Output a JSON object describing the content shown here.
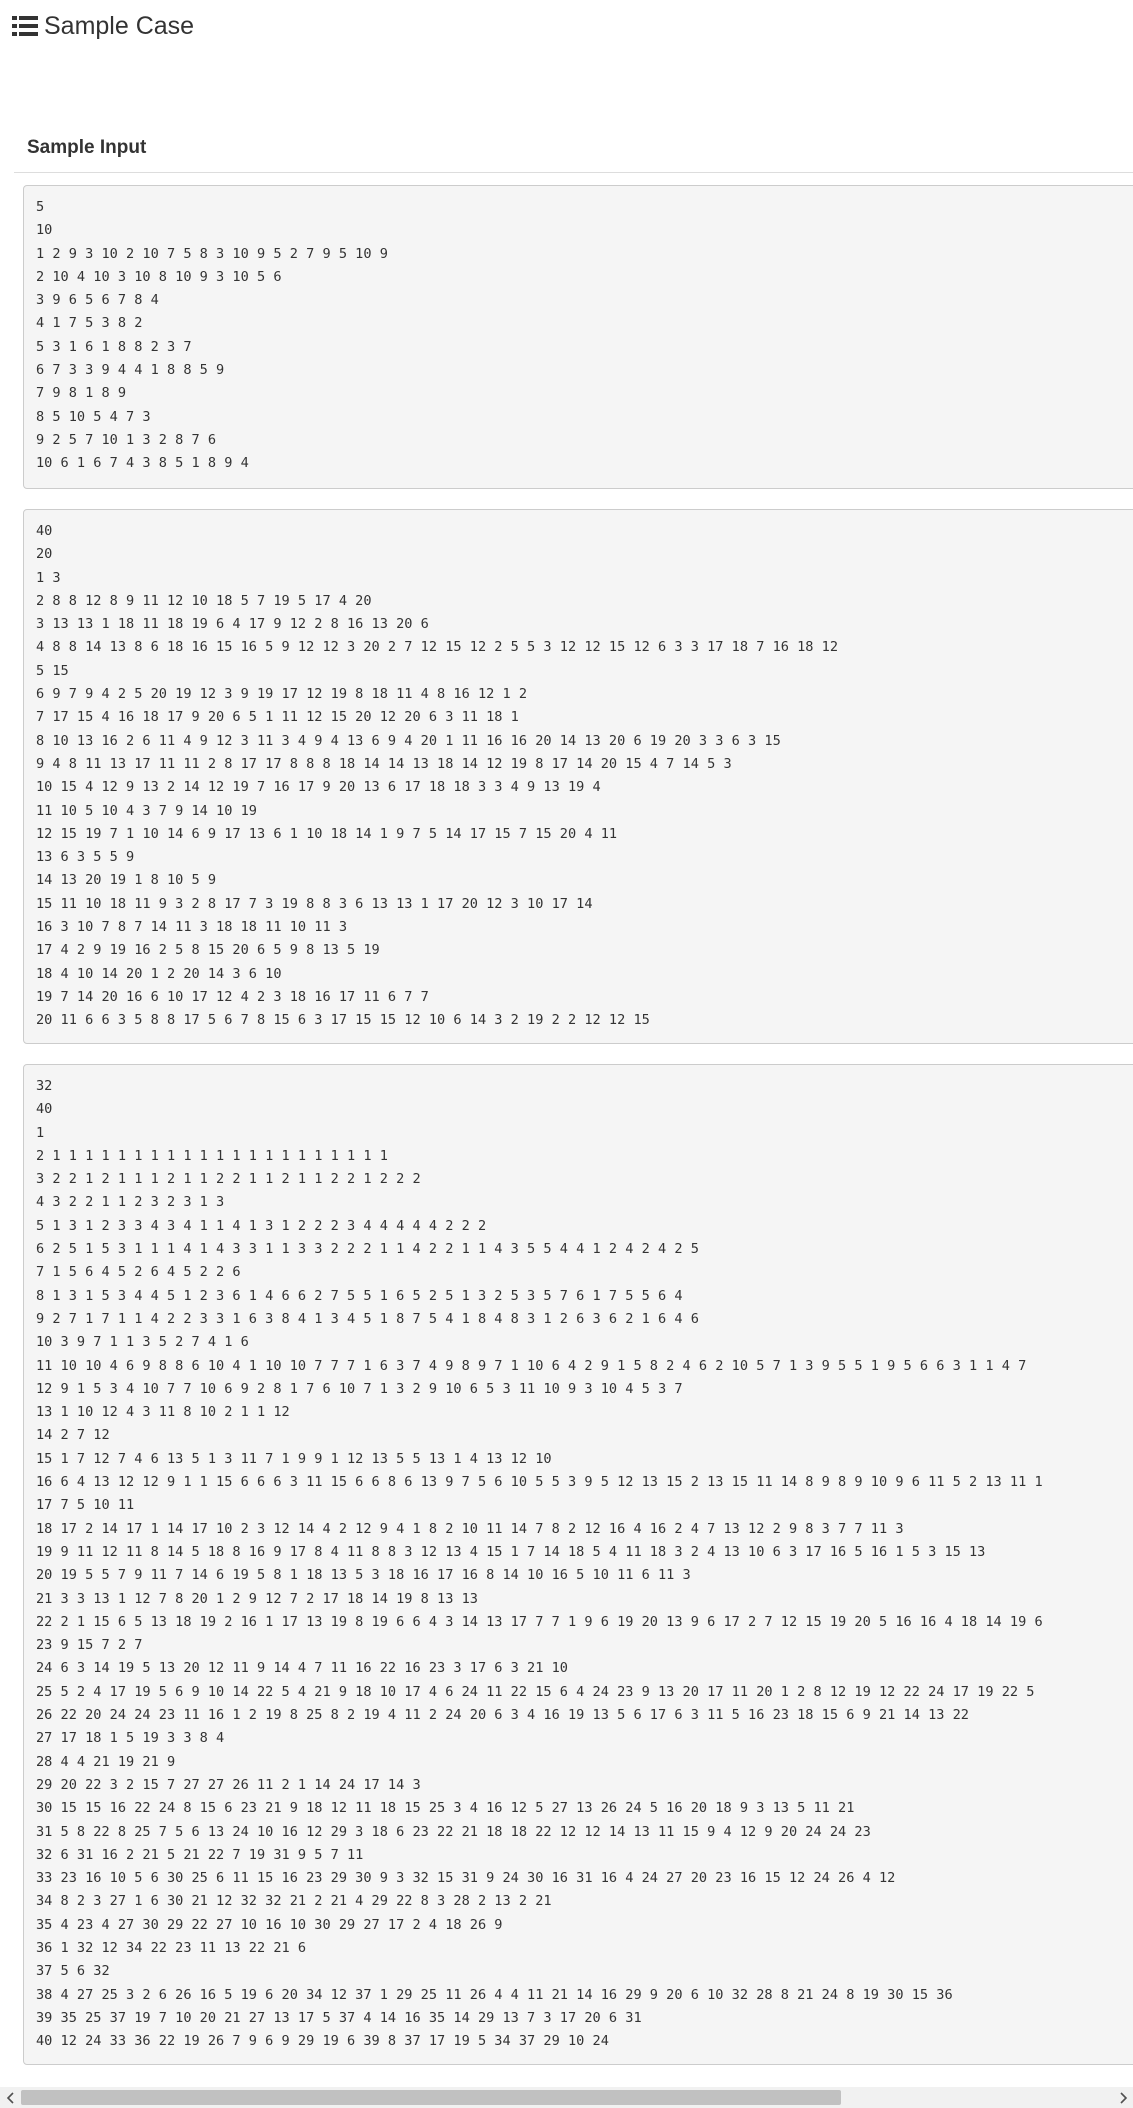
{
  "header": {
    "title": "Sample Case"
  },
  "section": {
    "title": "Sample Input"
  },
  "blocks": [
    {
      "lines": [
        "5",
        "10",
        "1 2 9 3 10 2 10 7 5 8 3 10 9 5 2 7 9 5 10 9",
        "2 10 4 10 3 10 8 10 9 3 10 5 6",
        "3 9 6 5 6 7 8 4",
        "4 1 7 5 3 8 2",
        "5 3 1 6 1 8 8 2 3 7",
        "6 7 3 3 9 4 4 1 8 8 5 9",
        "7 9 8 1 8 9",
        "8 5 10 5 4 7 3",
        "9 2 5 7 10 1 3 2 8 7 6",
        "10 6 1 6 7 4 3 8 5 1 8 9 4"
      ]
    },
    {
      "lines": [
        "40",
        "20",
        "1 3",
        "2 8 8 12 8 9 11 12 10 18 5 7 19 5 17 4 20",
        "3 13 13 1 18 11 18 19 6 4 17 9 12 2 8 16 13 20 6",
        "4 8 8 14 13 8 6 18 16 15 16 5 9 12 12 3 20 2 7 12 15 12 2 5 5 3 12 12 15 12 6 3 3 17 18 7 16 18 12",
        "5 15",
        "6 9 7 9 4 2 5 20 19 12 3 9 19 17 12 19 8 18 11 4 8 16 12 1 2",
        "7 17 15 4 16 18 17 9 20 6 5 1 11 12 15 20 12 20 6 3 11 18 1",
        "8 10 13 16 2 6 11 4 9 12 3 11 3 4 9 4 13 6 9 4 20 1 11 16 16 20 14 13 20 6 19 20 3 3 6 3 15",
        "9 4 8 11 13 17 11 11 2 8 17 17 8 8 8 18 14 14 13 18 14 12 19 8 17 14 20 15 4 7 14 5 3",
        "10 15 4 12 9 13 2 14 12 19 7 16 17 9 20 13 6 17 18 18 3 3 4 9 13 19 4",
        "11 10 5 10 4 3 7 9 14 10 19",
        "12 15 19 7 1 10 14 6 9 17 13 6 1 10 18 14 1 9 7 5 14 17 15 7 15 20 4 11",
        "13 6 3 5 5 9",
        "14 13 20 19 1 8 10 5 9",
        "15 11 10 18 11 9 3 2 8 17 7 3 19 8 8 3 6 13 13 1 17 20 12 3 10 17 14",
        "16 3 10 7 8 7 14 11 3 18 18 11 10 11 3",
        "17 4 2 9 19 16 2 5 8 15 20 6 5 9 8 13 5 19",
        "18 4 10 14 20 1 2 20 14 3 6 10",
        "19 7 14 20 16 6 10 17 12 4 2 3 18 16 17 11 6 7 7",
        "20 11 6 6 3 5 8 8 17 5 6 7 8 15 6 3 17 15 15 12 10 6 14 3 2 19 2 2 12 12 15"
      ]
    },
    {
      "lines": [
        "32",
        "40",
        "1",
        "2 1 1 1 1 1 1 1 1 1 1 1 1 1 1 1 1 1 1 1 1 1",
        "3 2 2 1 2 1 1 1 2 1 1 2 2 1 1 2 1 1 2 2 1 2 2 2",
        "4 3 2 2 1 1 2 3 2 3 1 3",
        "5 1 3 1 2 3 3 4 3 4 1 1 4 1 3 1 2 2 2 3 4 4 4 4 4 2 2 2",
        "6 2 5 1 5 3 1 1 1 4 1 4 3 3 1 1 3 3 2 2 2 1 1 4 2 2 1 1 4 3 5 5 4 4 1 2 4 2 4 2 5",
        "7 1 5 6 4 5 2 6 4 5 2 2 6",
        "8 1 3 1 5 3 4 4 5 1 2 3 6 1 4 6 6 2 7 5 5 1 6 5 2 5 1 3 2 5 3 5 7 6 1 7 5 5 6 4",
        "9 2 7 1 7 1 1 4 2 2 3 3 1 6 3 8 4 1 3 4 5 1 8 7 5 4 1 8 4 8 3 1 2 6 3 6 2 1 6 4 6",
        "10 3 9 7 1 1 3 5 2 7 4 1 6",
        "11 10 10 4 6 9 8 8 6 10 4 1 10 10 7 7 7 1 6 3 7 4 9 8 9 7 1 10 6 4 2 9 1 5 8 2 4 6 2 10 5 7 1 3 9 5 5 1 9 5 6 6 3 1 1 4 7",
        "12 9 1 5 3 4 10 7 7 10 6 9 2 8 1 7 6 10 7 1 3 2 9 10 6 5 3 11 10 9 3 10 4 5 3 7",
        "13 1 10 12 4 3 11 8 10 2 1 1 12",
        "14 2 7 12",
        "15 1 7 12 7 4 6 13 5 1 3 11 7 1 9 9 1 12 13 5 5 13 1 4 13 12 10",
        "16 6 4 13 12 12 9 1 1 15 6 6 6 3 11 15 6 6 8 6 13 9 7 5 6 10 5 5 3 9 5 12 13 15 2 13 15 11 14 8 9 8 9 10 9 6 11 5 2 13 11 1",
        "17 7 5 10 11",
        "18 17 2 14 17 1 14 17 10 2 3 12 14 4 2 12 9 4 1 8 2 10 11 14 7 8 2 12 16 4 16 2 4 7 13 12 2 9 8 3 7 7 11 3",
        "19 9 11 12 11 8 14 5 18 8 16 9 17 8 4 11 8 8 3 12 13 4 15 1 7 14 18 5 4 11 18 3 2 4 13 10 6 3 17 16 5 16 1 5 3 15 13",
        "20 19 5 5 7 9 11 7 14 6 19 5 8 1 18 13 5 3 18 16 17 16 8 14 10 16 5 10 11 6 11 3",
        "21 3 3 13 1 12 7 8 20 1 2 9 12 7 2 17 18 14 19 8 13 13",
        "22 2 1 15 6 5 13 18 19 2 16 1 17 13 19 8 19 6 6 4 3 14 13 17 7 7 1 9 6 19 20 13 9 6 17 2 7 12 15 19 20 5 16 16 4 18 14 19 6",
        "23 9 15 7 2 7",
        "24 6 3 14 19 5 13 20 12 11 9 14 4 7 11 16 22 16 23 3 17 6 3 21 10",
        "25 5 2 4 17 19 5 6 9 10 14 22 5 4 21 9 18 10 17 4 6 24 11 22 15 6 4 24 23 9 13 20 17 11 20 1 2 8 12 19 12 22 24 17 19 22 5",
        "26 22 20 24 24 23 11 16 1 2 19 8 25 8 2 19 4 11 2 24 20 6 3 4 16 19 13 5 6 17 6 3 11 5 16 23 18 15 6 9 21 14 13 22",
        "27 17 18 1 5 19 3 3 8 4",
        "28 4 4 21 19 21 9",
        "29 20 22 3 2 15 7 27 27 26 11 2 1 14 24 17 14 3",
        "30 15 15 16 22 24 8 15 6 23 21 9 18 12 11 18 15 25 3 4 16 12 5 27 13 26 24 5 16 20 18 9 3 13 5 11 21",
        "31 5 8 22 8 25 7 5 6 13 24 10 16 12 29 3 18 6 23 22 21 18 18 22 12 12 14 13 11 15 9 4 12 9 20 24 24 23",
        "32 6 31 16 2 21 5 21 22 7 19 31 9 5 7 11",
        "33 23 16 10 5 6 30 25 6 11 15 16 23 29 30 9 3 32 15 31 9 24 30 16 31 16 4 24 27 20 23 16 15 12 24 26 4 12",
        "34 8 2 3 27 1 6 30 21 12 32 32 21 2 21 4 29 22 8 3 28 2 13 2 21",
        "35 4 23 4 27 30 29 22 27 10 16 10 30 29 27 17 2 4 18 26 9",
        "36 1 32 12 34 22 23 11 13 22 21 6",
        "37 5 6 32",
        "38 4 27 25 3 2 6 26 16 5 19 6 20 34 12 37 1 29 25 11 26 4 4 11 21 14 16 29 9 20 6 10 32 28 8 21 24 8 19 30 15 36",
        "39 35 25 37 19 7 10 20 21 27 13 17 5 37 4 14 16 35 14 29 13 7 3 17 20 6 31",
        "40 12 24 33 36 22 19 26 7 9 6 9 29 19 6 39 8 37 17 19 5 34 37 29 10 24"
      ]
    }
  ],
  "scrollbar": {
    "left_arrow": "<",
    "right_arrow": ">"
  }
}
